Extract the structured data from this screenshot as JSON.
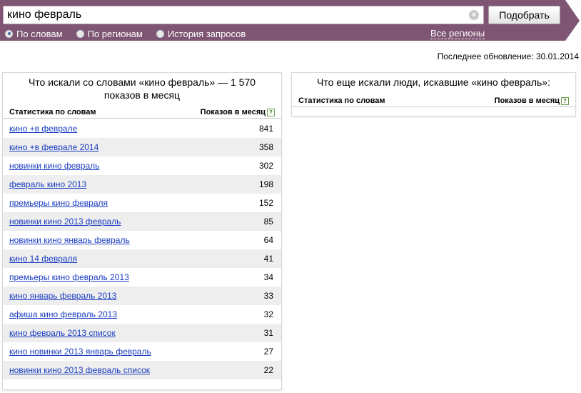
{
  "colors": {
    "topbar": "#7e5572",
    "link": "#1a3dc1",
    "alt_row": "#eeeeee"
  },
  "search": {
    "value": "кино февраль",
    "clear_icon": "×",
    "submit_label": "Подобрать"
  },
  "modes": [
    {
      "label": "По словам",
      "checked": true
    },
    {
      "label": "По регионам",
      "checked": false
    },
    {
      "label": "История запросов",
      "checked": false
    }
  ],
  "regions_link": "Все регионы",
  "last_update": "Последнее обновление: 30.01.2014",
  "left_panel": {
    "title": "Что искали со словами «кино февраль» — 1 570 показов в месяц",
    "col_query": "Статистика по словам",
    "col_count": "Показов в месяц",
    "help": "?",
    "rows": [
      {
        "query": "кино +в феврале",
        "count": "841"
      },
      {
        "query": "кино +в феврале 2014",
        "count": "358"
      },
      {
        "query": "новинки кино февраль",
        "count": "302"
      },
      {
        "query": "февраль кино 2013",
        "count": "198"
      },
      {
        "query": "премьеры кино февраля",
        "count": "152"
      },
      {
        "query": "новинки кино 2013 февраль",
        "count": "85"
      },
      {
        "query": "новинки кино январь февраль",
        "count": "64"
      },
      {
        "query": "кино 14 февраля",
        "count": "41"
      },
      {
        "query": "премьеры кино февраль 2013",
        "count": "34"
      },
      {
        "query": "кино январь февраль 2013",
        "count": "33"
      },
      {
        "query": "афиша кино февраль 2013",
        "count": "32"
      },
      {
        "query": "кино февраль 2013 список",
        "count": "31"
      },
      {
        "query": "кино новинки 2013 январь февраль",
        "count": "27"
      },
      {
        "query": "новинки кино 2013 февраль список",
        "count": "22"
      }
    ]
  },
  "right_panel": {
    "title": "Что еще искали люди, искавшие «кино февраль»:",
    "col_query": "Статистика по словам",
    "col_count": "Показов в месяц",
    "help": "?"
  }
}
